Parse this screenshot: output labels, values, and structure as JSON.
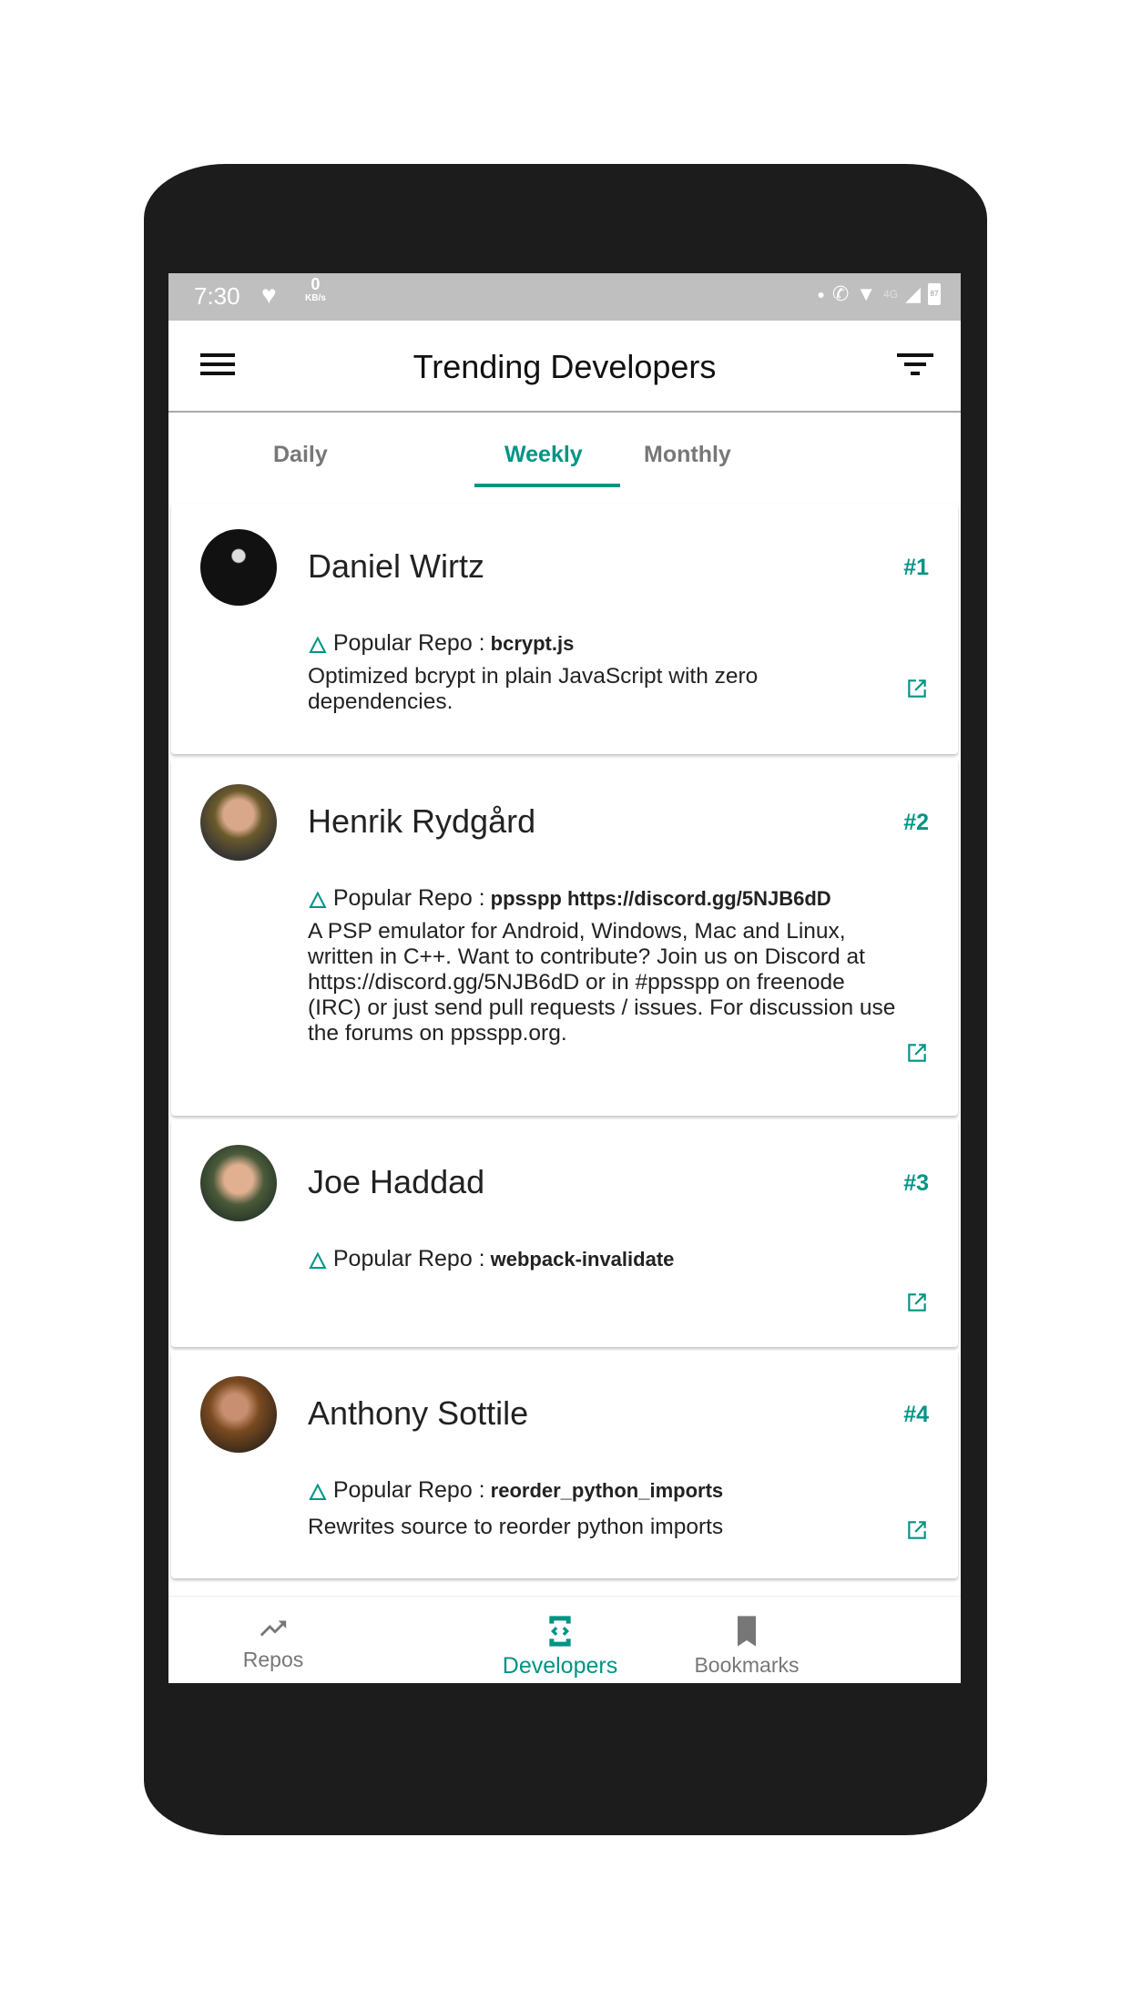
{
  "status_bar": {
    "time": "7:30",
    "speed_value": "0",
    "speed_unit": "KB/s",
    "network": "4G",
    "battery": "87"
  },
  "header": {
    "title": "Trending Developers"
  },
  "tabs": [
    {
      "label": "Daily"
    },
    {
      "label": "Weekly",
      "active": true
    },
    {
      "label": "Monthly"
    }
  ],
  "repo_label": "Popular Repo : ",
  "developers": [
    {
      "name": "Daniel Wirtz",
      "rank": "#1",
      "repo": "bcrypt.js",
      "description": "Optimized bcrypt in plain JavaScript with zero dependencies."
    },
    {
      "name": "Henrik Rydgård",
      "rank": "#2",
      "repo": "ppsspp https://discord.gg/5NJB6dD",
      "description": "A PSP emulator for Android, Windows, Mac and Linux, written in C++. Want to contribute? Join us on Discord at https://discord.gg/5NJB6dD or in #ppsspp on freenode (IRC) or just send pull requests / issues. For discussion use the forums on ppsspp.org."
    },
    {
      "name": "Joe Haddad",
      "rank": "#3",
      "repo": "webpack-invalidate",
      "description": ""
    },
    {
      "name": "Anthony Sottile",
      "rank": "#4",
      "repo": "reorder_python_imports",
      "description": "Rewrites source to reorder python imports"
    }
  ],
  "bottom_nav": [
    {
      "label": "Repos",
      "icon": "trending-up-icon"
    },
    {
      "label": "Developers",
      "icon": "developer-mode-icon",
      "active": true
    },
    {
      "label": "Bookmarks",
      "icon": "bookmark-icon"
    }
  ],
  "colors": {
    "accent": "#009485",
    "status_bar": "#bfbfbf",
    "phone_body": "#1c1c1c"
  }
}
